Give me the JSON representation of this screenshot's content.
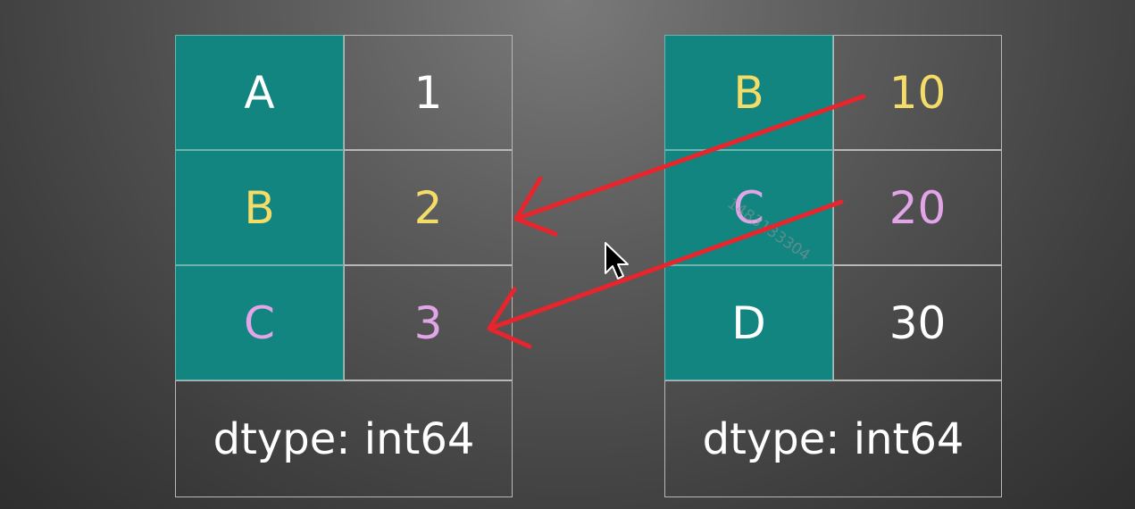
{
  "left_series": {
    "rows": [
      {
        "index": "A",
        "value": "1",
        "color": "#ffffff"
      },
      {
        "index": "B",
        "value": "2",
        "color": "#f3dc68"
      },
      {
        "index": "C",
        "value": "3",
        "color": "#e2a6e8"
      }
    ],
    "dtype": "dtype: int64"
  },
  "right_series": {
    "rows": [
      {
        "index": "B",
        "value": "10",
        "color": "#f3dc68"
      },
      {
        "index": "C",
        "value": "20",
        "color": "#e2a6e8"
      },
      {
        "index": "D",
        "value": "30",
        "color": "#ffffff"
      }
    ],
    "dtype": "dtype: int64"
  },
  "watermark": "1483133304",
  "colors": {
    "index_cell": "#138580",
    "arrow": "#e8242c",
    "cursor": "#000000"
  },
  "icons": {
    "cursor": "mouse-pointer-icon"
  }
}
